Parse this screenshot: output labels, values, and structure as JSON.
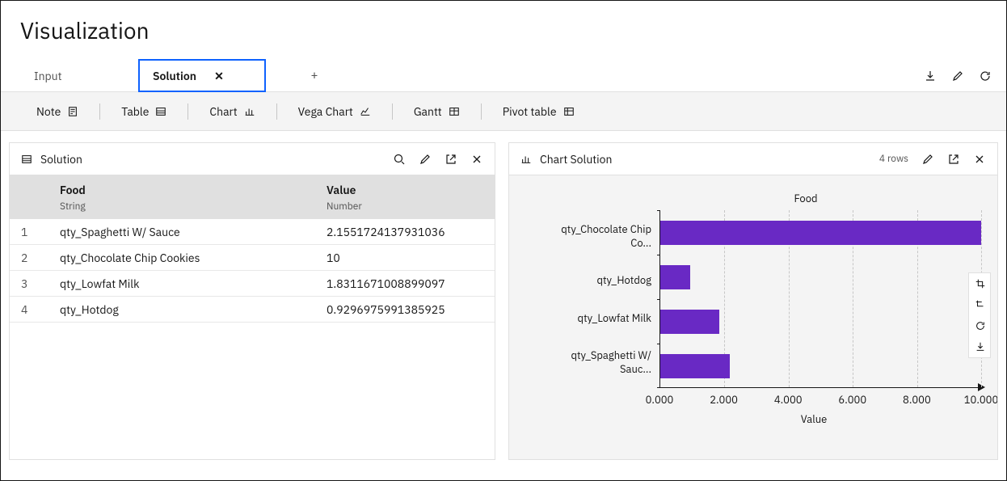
{
  "page_title": "Visualization",
  "tabs": [
    "Input",
    "Solution"
  ],
  "active_tab": "Solution",
  "toolbar": {
    "note": "Note",
    "table": "Table",
    "chart": "Chart",
    "vega": "Vega Chart",
    "gantt": "Gantt",
    "pivot": "Pivot table"
  },
  "panel_left": {
    "title": "Solution",
    "columns": [
      {
        "name": "Food",
        "type": "String"
      },
      {
        "name": "Value",
        "type": "Number"
      }
    ],
    "rows": [
      {
        "idx": 1,
        "food": "qty_Spaghetti W/ Sauce",
        "value": "2.1551724137931036"
      },
      {
        "idx": 2,
        "food": "qty_Chocolate Chip Cookies",
        "value": "10"
      },
      {
        "idx": 3,
        "food": "qty_Lowfat Milk",
        "value": "1.8311671008899097"
      },
      {
        "idx": 4,
        "food": "qty_Hotdog",
        "value": "0.9296975991385925"
      }
    ]
  },
  "panel_right": {
    "title": "Chart Solution",
    "rows_label": "4 rows"
  },
  "chart_data": {
    "type": "bar",
    "orientation": "horizontal",
    "title": "",
    "xlabel": "Value",
    "ylabel": "Food",
    "xlim": [
      0,
      10
    ],
    "xticks": [
      "0.000",
      "2.000",
      "4.000",
      "6.000",
      "8.000",
      "10.000"
    ],
    "categories": [
      "qty_Chocolate Chip Co...",
      "qty_Hotdog",
      "qty_Lowfat Milk",
      "qty_Spaghetti W/ Sauc..."
    ],
    "values": [
      10,
      0.9296975991385925,
      1.8311671008899097,
      2.1551724137931036
    ],
    "color": "#6929c4"
  }
}
